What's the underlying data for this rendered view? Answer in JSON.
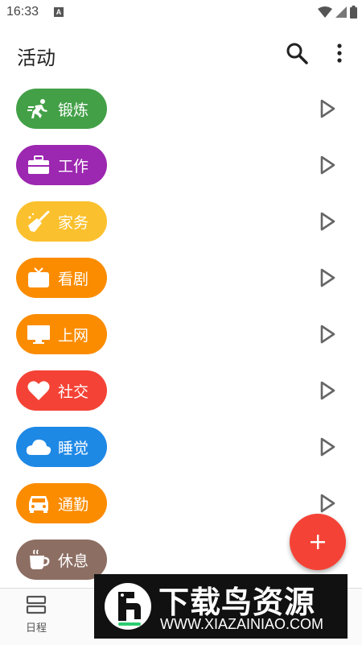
{
  "status_bar": {
    "time": "16:33",
    "notification_letter": "A"
  },
  "app_bar": {
    "title": "活动",
    "search_icon": "search-icon",
    "more_icon": "more-vert-icon"
  },
  "activities": [
    {
      "label": "锻炼",
      "icon": "running-icon",
      "color": "#43a047"
    },
    {
      "label": "工作",
      "icon": "briefcase-icon",
      "color": "#9c27b0"
    },
    {
      "label": "家务",
      "icon": "broom-icon",
      "color": "#fbc02d"
    },
    {
      "label": "看剧",
      "icon": "tv-icon",
      "color": "#fb8c00"
    },
    {
      "label": "上网",
      "icon": "monitor-icon",
      "color": "#fb8c00"
    },
    {
      "label": "社交",
      "icon": "heart-icon",
      "color": "#f44336"
    },
    {
      "label": "睡觉",
      "icon": "cloud-icon",
      "color": "#1e88e5"
    },
    {
      "label": "通勤",
      "icon": "car-icon",
      "color": "#fb8c00"
    },
    {
      "label": "休息",
      "icon": "coffee-icon",
      "color": "#8d6e63"
    }
  ],
  "fab": {
    "icon": "plus-icon",
    "color": "#f44336"
  },
  "bottom_nav": {
    "schedule_label": "日程"
  },
  "watermark": {
    "title": "下载鸟资源",
    "url": "WWW.XIAZAINIAO.COM"
  }
}
